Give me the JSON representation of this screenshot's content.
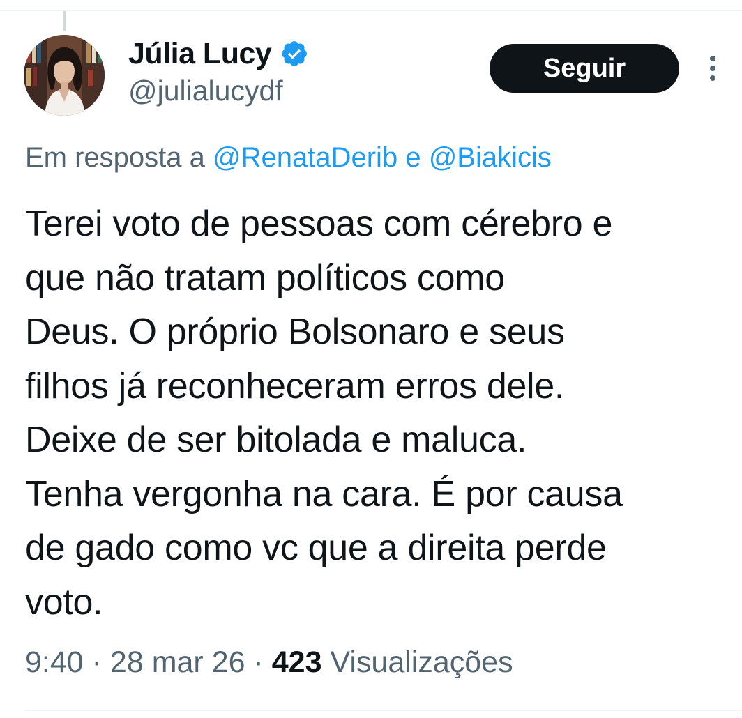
{
  "tweet": {
    "author": {
      "display_name": "Júlia Lucy",
      "handle": "@julialucydf",
      "verified_icon": "verified-badge-icon",
      "avatar_icon": "profile-photo"
    },
    "follow_label": "Seguir",
    "more_icon": "more-vertical-icon",
    "reply_context": {
      "prefix": "Em resposta a ",
      "mention_1": "@RenataDerib",
      "joiner": " e ",
      "mention_2": "@Biakicis"
    },
    "text_lines": [
      "Terei voto de pessoas com cérebro e",
      "que não tratam políticos como",
      "Deus. O próprio Bolsonaro e seus",
      "filhos já reconheceram erros dele.",
      "Deixe de ser bitolada e maluca.",
      "Tenha vergonha na cara. É por causa",
      "de gado como vc que a direita perde",
      "voto."
    ],
    "time": "9:40",
    "separator_1": " · ",
    "date": "28 mar 26",
    "separator_2": " · ",
    "views_count": "423",
    "views_label": " Visualizações"
  },
  "colors": {
    "text": "#0f1419",
    "secondary": "#536471",
    "link": "#1d9bf0",
    "button_bg": "#0f1419",
    "divider": "#eff3f4"
  }
}
